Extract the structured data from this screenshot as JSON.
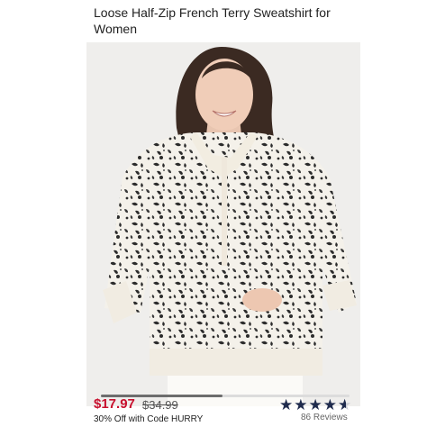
{
  "product": {
    "title": "Loose Half-Zip French Terry Sweatshirt for Women"
  },
  "carousel": {
    "progress": 0.49
  },
  "pricing": {
    "sale_price": "$17.97",
    "original_price": "$34.99",
    "promo": "30% Off with Code HURRY"
  },
  "rating": {
    "stars": 4.5,
    "star_color": "#1f2b4d",
    "reviews": "86 Reviews"
  },
  "colors": {
    "sale_price": "#c8102e"
  }
}
